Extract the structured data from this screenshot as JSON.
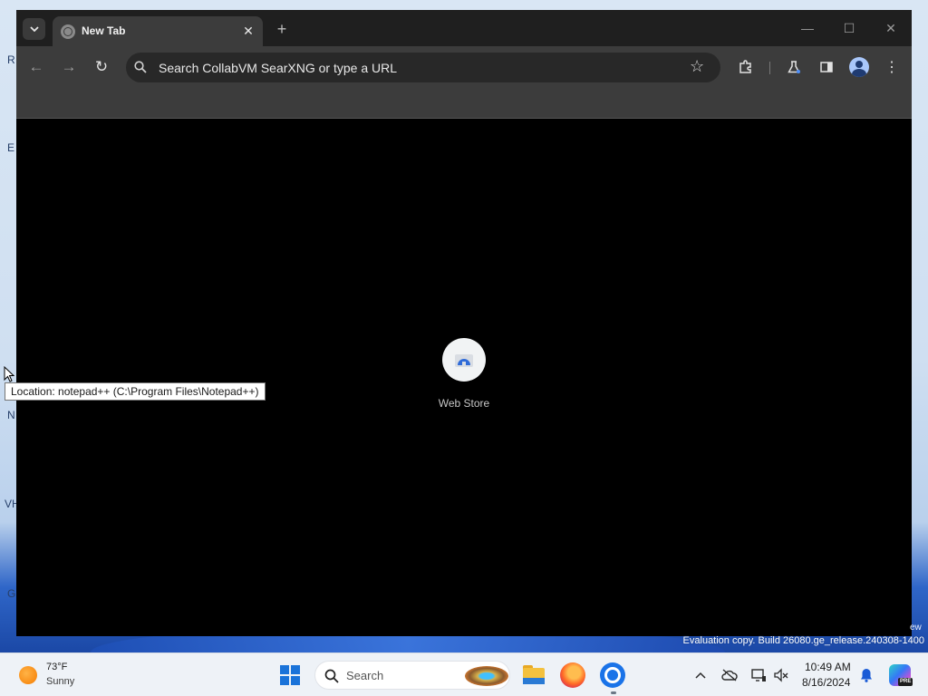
{
  "desktop": {
    "edge_glyphs": [
      "R",
      "E",
      "N",
      "VH",
      "G"
    ],
    "eval_text": "Evaluation copy. Build 26080.ge_release.240308-1400",
    "eval_ghost": "ew"
  },
  "browser": {
    "tab": {
      "title": "New Tab",
      "favicon": "globe-icon"
    },
    "omnibox": {
      "placeholder": "Search CollabVM SearXNG or type a URL"
    },
    "shortcuts": [
      {
        "label": "Web Store",
        "icon": "web-store-icon"
      }
    ]
  },
  "tooltip": {
    "text": "Location: notepad++ (C:\\Program Files\\Notepad++)"
  },
  "taskbar": {
    "weather": {
      "temp": "73°F",
      "condition": "Sunny"
    },
    "search_label": "Search",
    "clock": {
      "time": "10:49 AM",
      "date": "8/16/2024"
    },
    "copilot_badge": "PRE"
  },
  "colors": {
    "chrome_dark": "#3c3c3c",
    "content_bg": "#000000",
    "accent_blue": "#1a73e8",
    "taskbar_bg": "#eef2f7"
  }
}
